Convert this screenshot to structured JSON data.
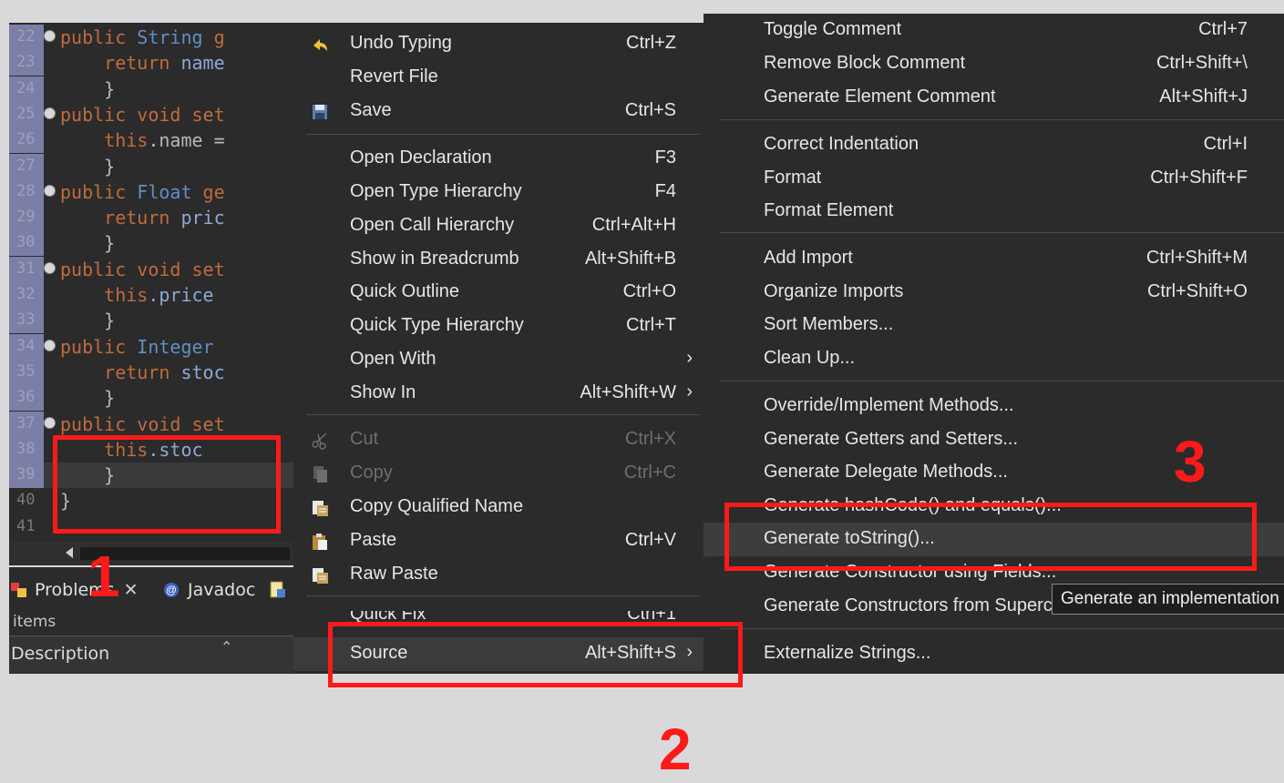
{
  "editor": {
    "lines": [
      {
        "n": "22",
        "fold": true,
        "parts": [
          [
            "kw",
            "public "
          ],
          [
            "ty",
            "String "
          ],
          [
            "kw",
            "g"
          ]
        ]
      },
      {
        "n": "23",
        "fold": false,
        "parts": [
          [
            "",
            "    "
          ],
          [
            "kw",
            "return "
          ],
          [
            "fld",
            "name"
          ]
        ]
      },
      {
        "n": "24",
        "fold": false,
        "parts": [
          [
            "",
            "    }"
          ]
        ]
      },
      {
        "n": "25",
        "fold": true,
        "parts": [
          [
            "kw",
            "public void "
          ],
          [
            "kw",
            "set"
          ]
        ]
      },
      {
        "n": "26",
        "fold": false,
        "parts": [
          [
            "",
            "    "
          ],
          [
            "kw",
            "this"
          ],
          [
            "",
            ".name ="
          ]
        ]
      },
      {
        "n": "27",
        "fold": false,
        "parts": [
          [
            "",
            "    }"
          ]
        ]
      },
      {
        "n": "28",
        "fold": true,
        "parts": [
          [
            "kw",
            "public "
          ],
          [
            "ty",
            "Float "
          ],
          [
            "kw",
            "ge"
          ]
        ]
      },
      {
        "n": "29",
        "fold": false,
        "parts": [
          [
            "",
            "    "
          ],
          [
            "kw",
            "return "
          ],
          [
            "fld",
            "pric"
          ]
        ]
      },
      {
        "n": "30",
        "fold": false,
        "parts": [
          [
            "",
            "    }"
          ]
        ]
      },
      {
        "n": "31",
        "fold": true,
        "parts": [
          [
            "kw",
            "public void "
          ],
          [
            "kw",
            "set"
          ]
        ]
      },
      {
        "n": "32",
        "fold": false,
        "parts": [
          [
            "",
            "    "
          ],
          [
            "kw",
            "this"
          ],
          [
            "fld",
            ".price"
          ]
        ]
      },
      {
        "n": "33",
        "fold": false,
        "parts": [
          [
            "",
            "    }"
          ]
        ]
      },
      {
        "n": "34",
        "fold": true,
        "parts": [
          [
            "kw",
            "public "
          ],
          [
            "ty",
            "Integer"
          ]
        ]
      },
      {
        "n": "35",
        "fold": false,
        "parts": [
          [
            "",
            "    "
          ],
          [
            "kw",
            "return "
          ],
          [
            "fld",
            "stoc"
          ]
        ]
      },
      {
        "n": "36",
        "fold": false,
        "parts": [
          [
            "",
            "    }"
          ]
        ]
      },
      {
        "n": "37",
        "fold": true,
        "parts": [
          [
            "kw",
            "public void "
          ],
          [
            "kw",
            "set"
          ]
        ]
      },
      {
        "n": "38",
        "fold": false,
        "parts": [
          [
            "",
            "    "
          ],
          [
            "kw",
            "this"
          ],
          [
            "fld",
            ".stoc"
          ]
        ]
      },
      {
        "n": "39",
        "fold": false,
        "parts": [
          [
            "",
            "    }"
          ]
        ],
        "hl": true
      },
      {
        "n": "40",
        "fold": false,
        "parts": [
          [
            "",
            "}"
          ]
        ],
        "plain": true
      },
      {
        "n": "41",
        "fold": false,
        "parts": [
          [
            "",
            ""
          ]
        ],
        "plain": true
      }
    ]
  },
  "panel": {
    "tabs": [
      {
        "label": "Problems",
        "icon": "problems-icon",
        "close": "✕"
      },
      {
        "label": "Javadoc",
        "icon": "javadoc-icon"
      }
    ],
    "items_label": "items",
    "column_header": "Description"
  },
  "context_menu": {
    "items": [
      {
        "label": "Undo Typing",
        "accel": "Ctrl+Z",
        "icon": "undo-icon"
      },
      {
        "label": "Revert File",
        "accel": ""
      },
      {
        "label": "Save",
        "accel": "Ctrl+S",
        "icon": "save-icon"
      },
      {
        "label": "Open Declaration",
        "accel": "F3"
      },
      {
        "label": "Open Type Hierarchy",
        "accel": "F4"
      },
      {
        "label": "Open Call Hierarchy",
        "accel": "Ctrl+Alt+H"
      },
      {
        "label": "Show in Breadcrumb",
        "accel": "Alt+Shift+B"
      },
      {
        "label": "Quick Outline",
        "accel": "Ctrl+O"
      },
      {
        "label": "Quick Type Hierarchy",
        "accel": "Ctrl+T"
      },
      {
        "label": "Open With",
        "accel": "",
        "submenu": true
      },
      {
        "label": "Show In",
        "accel": "Alt+Shift+W",
        "submenu": true
      },
      {
        "label": "Cut",
        "accel": "Ctrl+X",
        "disabled": true,
        "icon": "cut-icon"
      },
      {
        "label": "Copy",
        "accel": "Ctrl+C",
        "disabled": true,
        "icon": "copy-icon"
      },
      {
        "label": "Copy Qualified Name",
        "accel": "",
        "icon": "copy-qualified-name-icon"
      },
      {
        "label": "Paste",
        "accel": "Ctrl+V",
        "icon": "paste-icon"
      },
      {
        "label": "Raw Paste",
        "accel": "",
        "icon": "raw-paste-icon"
      },
      {
        "label": "Quick Fix",
        "accel": "Ctrl+1",
        "partial": true
      },
      {
        "label": "Source",
        "accel": "Alt+Shift+S",
        "submenu": true,
        "selected": true
      }
    ],
    "submenu_arrow": "›"
  },
  "source_submenu": {
    "items": [
      {
        "label": "Toggle Comment",
        "accel": "Ctrl+7"
      },
      {
        "label": "Remove Block Comment",
        "accel": "Ctrl+Shift+\\"
      },
      {
        "label": "Generate Element Comment",
        "accel": "Alt+Shift+J"
      },
      {
        "label": "Correct Indentation",
        "accel": "Ctrl+I"
      },
      {
        "label": "Format",
        "accel": "Ctrl+Shift+F"
      },
      {
        "label": "Format Element",
        "accel": ""
      },
      {
        "label": "Add Import",
        "accel": "Ctrl+Shift+M"
      },
      {
        "label": "Organize Imports",
        "accel": "Ctrl+Shift+O"
      },
      {
        "label": "Sort Members...",
        "accel": ""
      },
      {
        "label": "Clean Up...",
        "accel": ""
      },
      {
        "label": "Override/Implement Methods...",
        "accel": ""
      },
      {
        "label": "Generate Getters and Setters...",
        "accel": ""
      },
      {
        "label": "Generate Delegate Methods...",
        "accel": ""
      },
      {
        "label": "Generate hashCode() and equals()...",
        "accel": "",
        "partial": true
      },
      {
        "label": "Generate toString()...",
        "accel": "",
        "selected": true
      },
      {
        "label": "Generate Constructor using Fields...",
        "accel": "",
        "partial": true
      },
      {
        "label": "Generate Constructors from Superclass...",
        "accel": ""
      },
      {
        "label": "Externalize Strings...",
        "accel": ""
      }
    ],
    "tooltip": "Generate an implementation of toString()"
  },
  "annotations": {
    "step1": "1",
    "step2": "2",
    "step3": "3",
    "color": "#ff1a1a"
  }
}
